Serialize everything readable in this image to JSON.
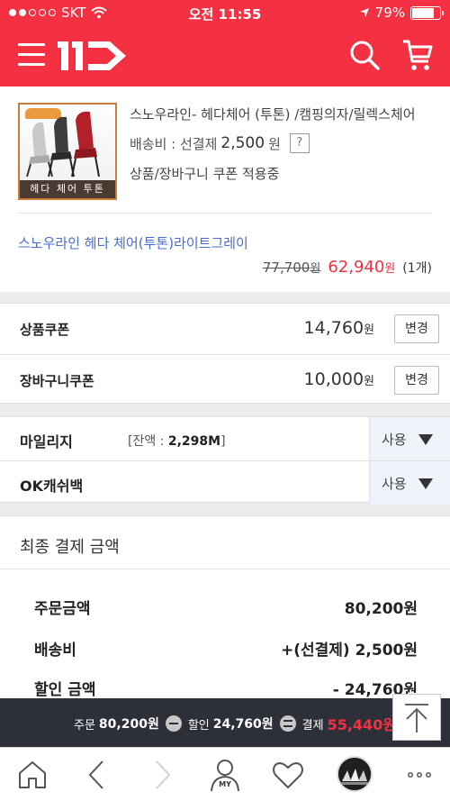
{
  "status_bar": {
    "carrier": "SKT",
    "time": "오전 11:55",
    "battery": "79%",
    "battery_level": 0.79
  },
  "header": {
    "logo_text": "11",
    "menu_icon": "hamburger-menu-icon",
    "search_icon": "search-icon",
    "cart_icon": "cart-icon",
    "brand_color": "#f43142"
  },
  "product": {
    "thumb_caption": "헤다 체어 투톤",
    "title": "스노우라인- 헤다체어 (투톤) /캠핑의자/릴렉스체어",
    "shipping_label": "배송비 : 선결제",
    "shipping_amount": "2,500",
    "shipping_unit": "원",
    "help_button": "?",
    "coupon_note": "상품/장바구니 쿠폰 적용중",
    "option": "스노우라인 헤다 체어(투톤)라이트그레이",
    "original_price": "77,700",
    "original_unit": "원",
    "sale_price": "62,940",
    "sale_unit": "원",
    "quantity": "(1개)"
  },
  "coupons": [
    {
      "label": "상품쿠폰",
      "amount": "14,760",
      "unit": "원",
      "button": "변경"
    },
    {
      "label": "장바구니쿠폰",
      "amount": "10,000",
      "unit": "원",
      "button": "변경"
    }
  ],
  "points": [
    {
      "label": "마일리지",
      "balance_prefix": "[잔액 : ",
      "balance": "2,298M",
      "balance_suffix": "]",
      "use": "사용"
    },
    {
      "label": "OK캐쉬백",
      "use": "사용"
    }
  ],
  "final": {
    "heading": "최종 결제 금액",
    "rows": [
      {
        "label": "주문금액",
        "value": "80,200원"
      },
      {
        "label": "배송비",
        "value": "+(선결제) 2,500원"
      },
      {
        "label": "할인 금액",
        "value": "- 24,760원"
      }
    ]
  },
  "summary": {
    "order_label": "주문",
    "order_amount": "80,200원",
    "discount_label": "할인",
    "discount_amount": "24,760원",
    "pay_label": "결제",
    "pay_amount": "55,440원"
  },
  "tabbar": {
    "my_label": "MY",
    "icons": [
      "home-icon",
      "back-icon",
      "forward-icon",
      "my-icon",
      "heart-icon",
      "recent-item-icon",
      "more-icon"
    ]
  }
}
